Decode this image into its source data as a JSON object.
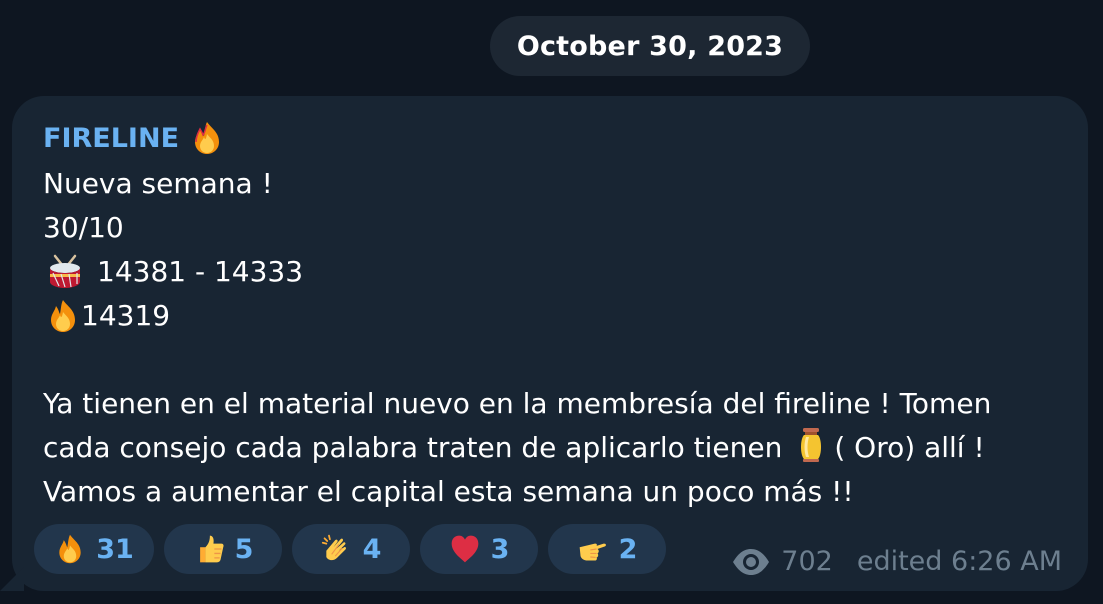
{
  "date_separator": "October 30, 2023",
  "message": {
    "sender": "FIRELINE",
    "sender_emoji": "fire-icon",
    "lines": {
      "l1": "Nueva semana !",
      "l2": "30/10",
      "l3": "14381 - 14333",
      "l4": "14319",
      "p1": "Ya tienen en el material nuevo en la membresía del fireline ! Tomen",
      "p2a": "cada consejo cada palabra traten de aplicarlo tienen",
      "p2b": "( Oro) allí !",
      "p3": "Vamos a aumentar el capital esta semana un poco más !!"
    },
    "line_icons": {
      "l3": "drum-icon",
      "l4": "fire-icon",
      "p2": "urn-icon"
    }
  },
  "reactions": [
    {
      "icon": "fire-icon",
      "count": "31"
    },
    {
      "icon": "thumbs-up-icon",
      "count": "5"
    },
    {
      "icon": "clapping-hands-icon",
      "count": "4"
    },
    {
      "icon": "red-heart-icon",
      "count": "3"
    },
    {
      "icon": "pointing-hand-icon",
      "count": "2"
    }
  ],
  "meta": {
    "views": "702",
    "edited_label": "edited 6:26 AM"
  },
  "colors": {
    "background": "#0e1621",
    "bubble": "#182533",
    "sender_accent": "#6ab2f2",
    "reaction_bg": "#22364c",
    "meta_text": "#6d7f8f"
  }
}
